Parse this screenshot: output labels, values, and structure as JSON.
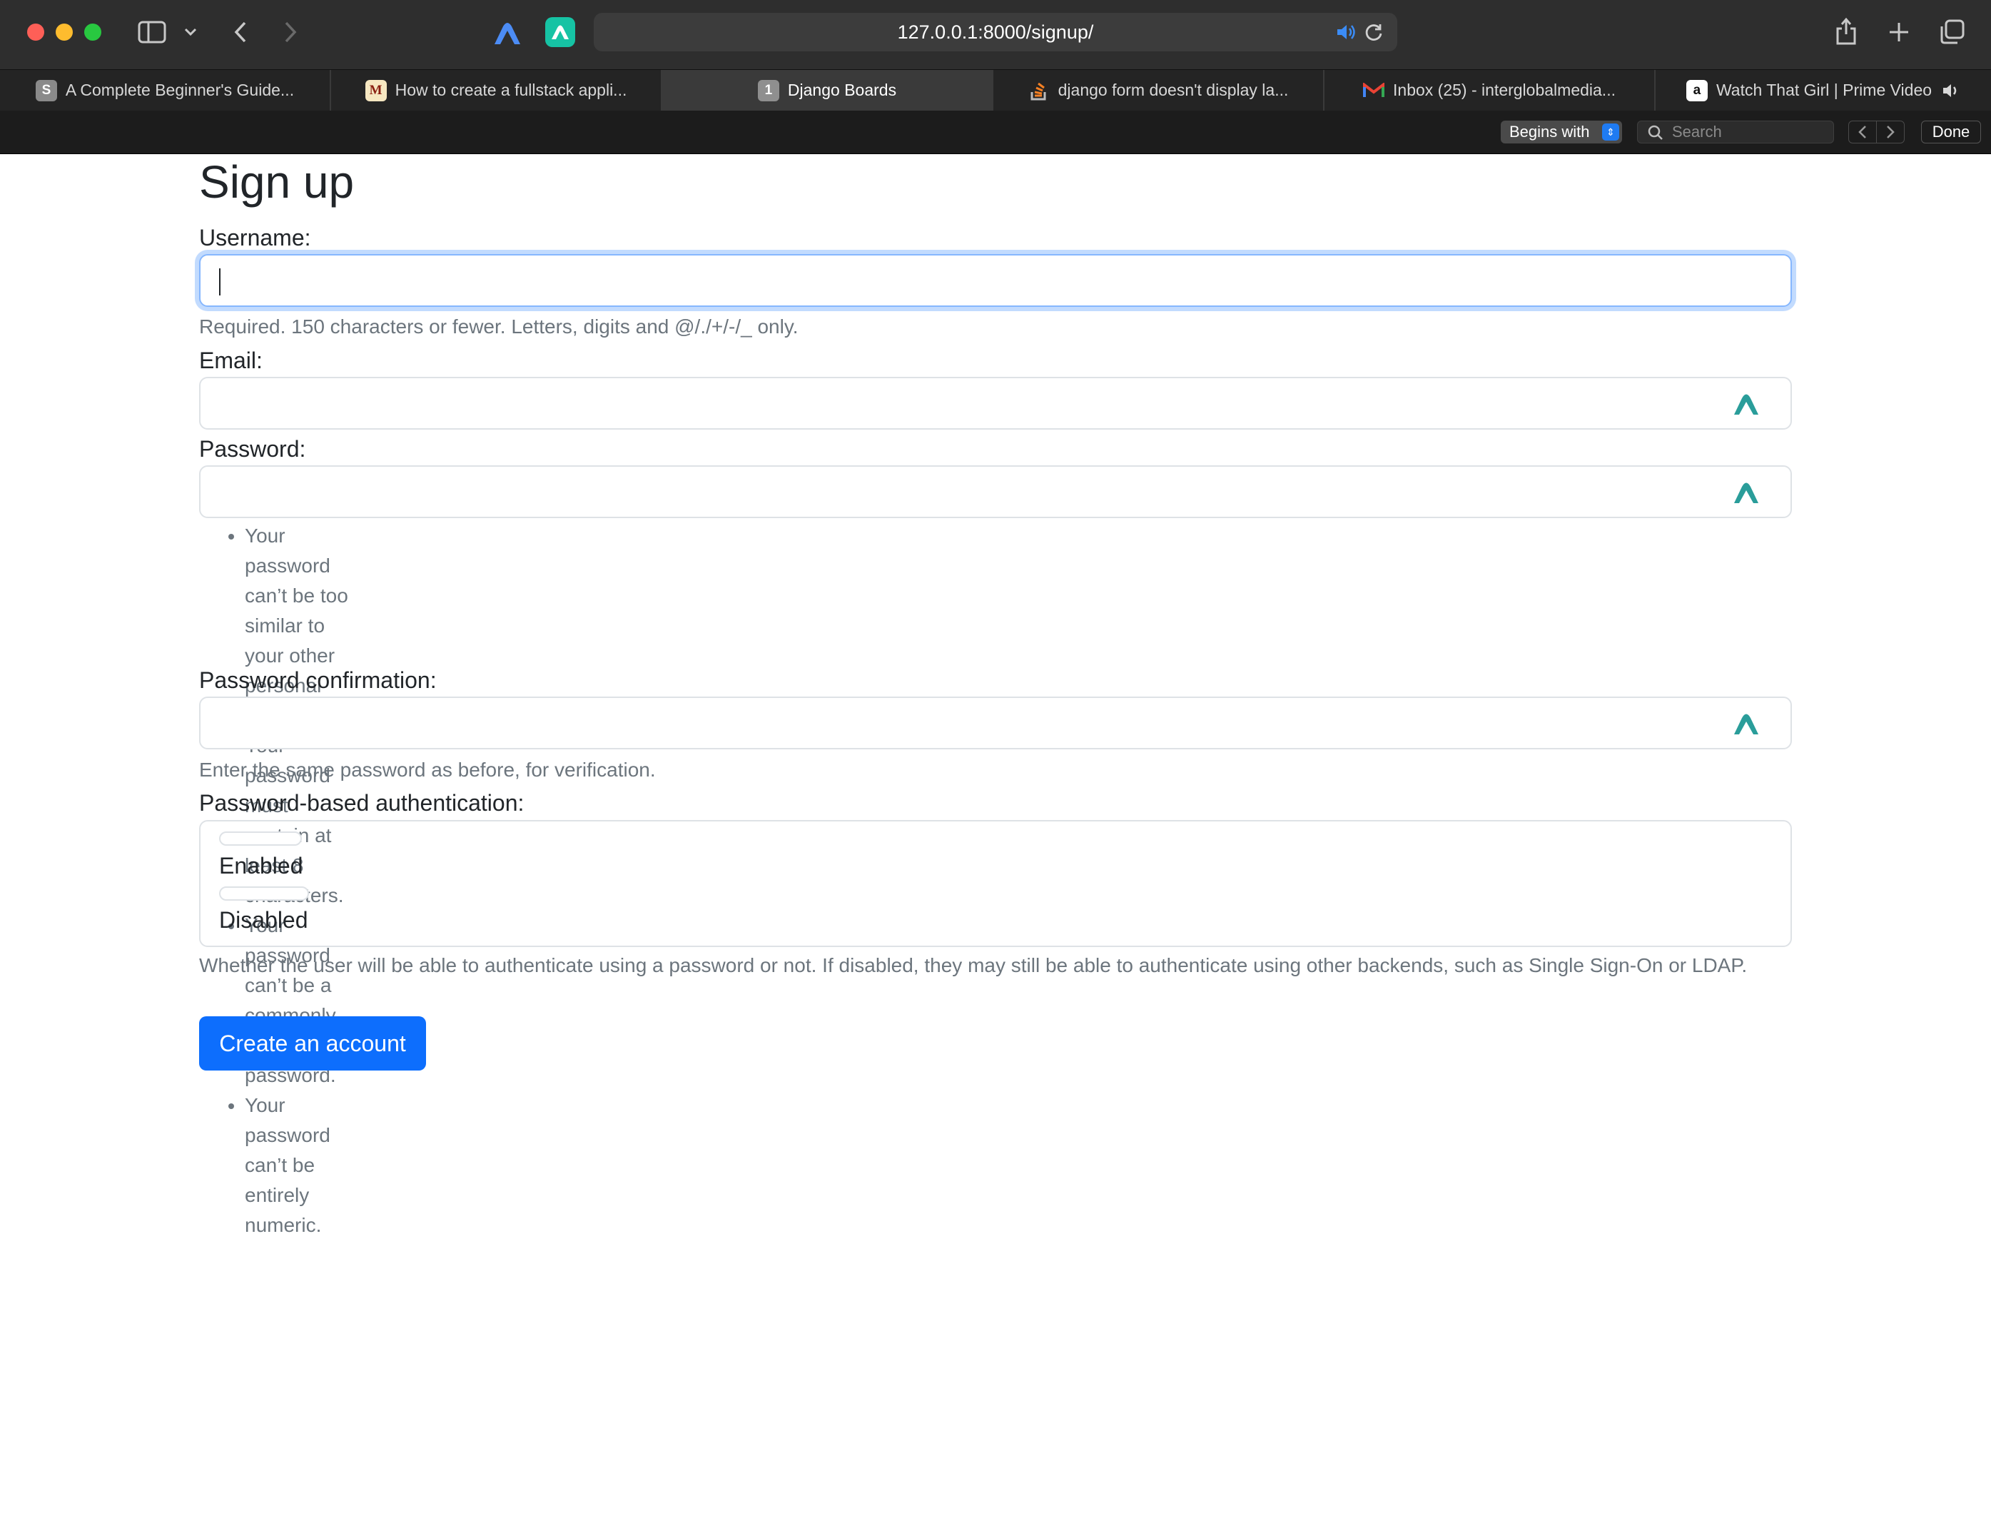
{
  "browser": {
    "url": "127.0.0.1:8000/signup/",
    "tabs": [
      {
        "title": "A Complete Beginner's Guide...",
        "favicon": "S"
      },
      {
        "title": "How to create a fullstack appli...",
        "favicon": "M"
      },
      {
        "title": "Django Boards",
        "favicon": "1",
        "active": true
      },
      {
        "title": "django form doesn't display la...",
        "favicon": "stackoverflow-icon"
      },
      {
        "title": "Inbox (25) - interglobalmedia...",
        "favicon": "gmail-icon"
      },
      {
        "title": "Watch That Girl | Prime Video",
        "favicon": "a"
      }
    ],
    "find_bar": {
      "mode": "Begins with",
      "search_placeholder": "Search",
      "done_label": "Done"
    }
  },
  "form": {
    "title": "Sign up",
    "username": {
      "label": "Username:",
      "help": "Required. 150 characters or fewer. Letters, digits and @/./+/-/_ only."
    },
    "email": {
      "label": "Email:"
    },
    "password": {
      "label": "Password:",
      "help": [
        "Your password can’t be too similar to your other personal information.",
        "Your password must contain at least 8 characters.",
        "Your password can’t be a commonly used password.",
        "Your password can’t be entirely numeric."
      ]
    },
    "password_confirmation": {
      "label": "Password confirmation:",
      "help": "Enter the same password as before, for verification."
    },
    "password_auth": {
      "label": "Password-based authentication:",
      "options": [
        "Enabled",
        "Disabled"
      ],
      "help": "Whether the user will be able to authenticate using a password or not. If disabled, they may still be able to authenticate using other backends, such as Single Sign-On or LDAP."
    },
    "submit_label": "Create an account"
  },
  "colors": {
    "primary": "#0d6efd",
    "vpn_teal": "#2a9d9a",
    "muted_text": "#6c757d"
  }
}
